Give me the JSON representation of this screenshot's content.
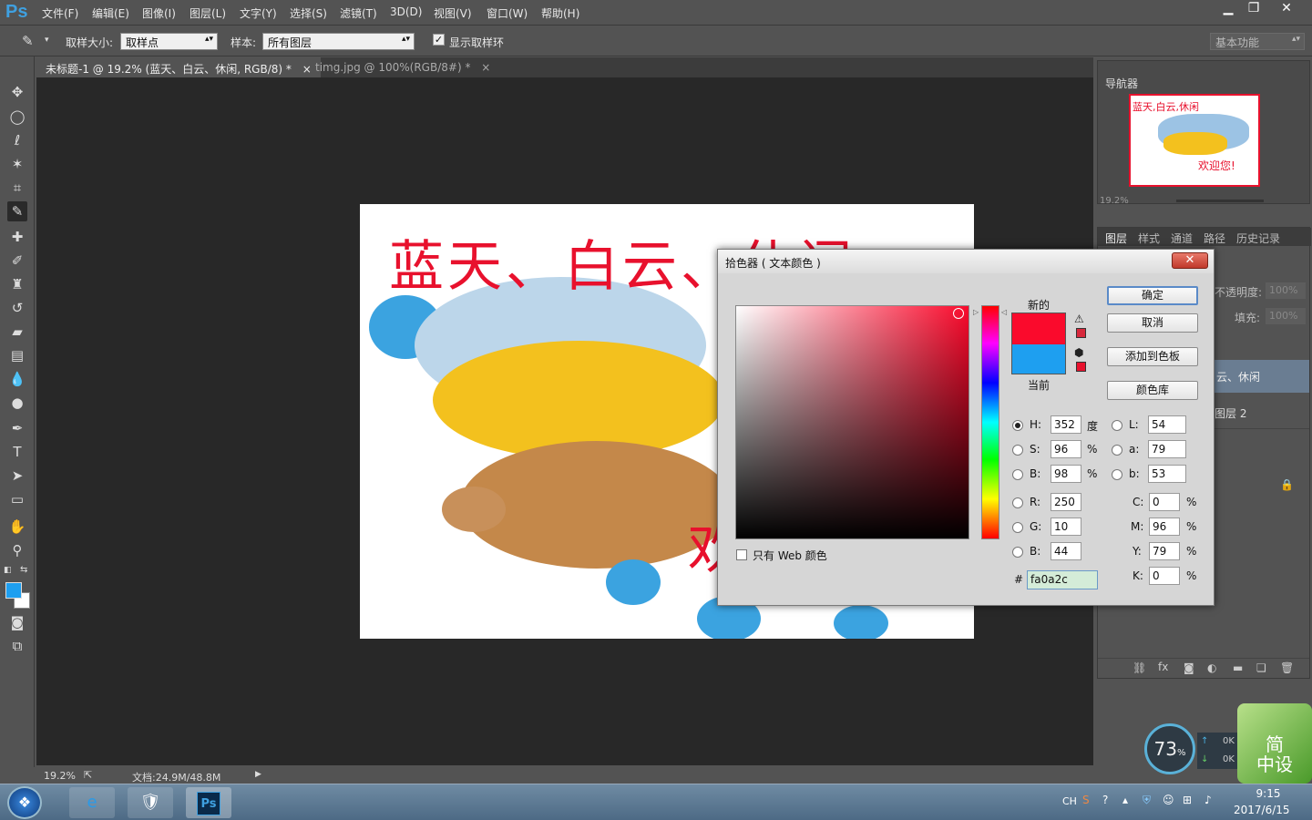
{
  "app": {
    "logo": "Ps"
  },
  "menu": [
    "文件(F)",
    "编辑(E)",
    "图像(I)",
    "图层(L)",
    "文字(Y)",
    "选择(S)",
    "滤镜(T)",
    "3D(D)",
    "视图(V)",
    "窗口(W)",
    "帮助(H)"
  ],
  "window_controls": [
    "minimize-icon",
    "restore-icon",
    "close-icon"
  ],
  "options": {
    "sample_size_label": "取样大小:",
    "sample_size_value": "取样点",
    "sample_label": "样本:",
    "sample_value": "所有图层",
    "show_ring_label": "显示取样环",
    "workspace": "基本功能"
  },
  "tabs": [
    {
      "label": "未标题-1 @ 19.2% (蓝天、白云、休闲, RGB/8) *",
      "close": "×"
    },
    {
      "label": "timg.jpg @ 100%(RGB/8#) *",
      "close": "×"
    }
  ],
  "canvas": {
    "headline": "蓝天、白云、休闲",
    "partial_text": "欢"
  },
  "status": {
    "zoom": "19.2%",
    "doc": "文档:24.9M/48.8M"
  },
  "navigator": {
    "title": "导航器",
    "zoom": "19.2%",
    "thumb_text_top": "蓝天,白云,休闲",
    "thumb_text_bottom": "欢迎您!"
  },
  "layers_panel": {
    "tabs": [
      "图层",
      "样式",
      "通道",
      "路径",
      "历史记录"
    ],
    "opacity_label": "不透明度:",
    "opacity_value": "100%",
    "fill_label": "填充:",
    "fill_value": "100%",
    "layers": [
      "云、休闲",
      "图层 2"
    ]
  },
  "dialog": {
    "title": "拾色器 ( 文本颜色 )",
    "close": "✕",
    "new_label": "新的",
    "current_label": "当前",
    "new_color": "#fa0a2c",
    "current_color": "#1e9ff0",
    "buttons": {
      "ok": "确定",
      "cancel": "取消",
      "add_swatch": "添加到色板",
      "libraries": "颜色库"
    },
    "web_only": "只有 Web 颜色",
    "hsb": {
      "h_label": "H:",
      "h": "352",
      "h_unit": "度",
      "s_label": "S:",
      "s": "96",
      "s_unit": "%",
      "b_label": "B:",
      "b": "98",
      "b_unit": "%"
    },
    "rgb": {
      "r_label": "R:",
      "r": "250",
      "g_label": "G:",
      "g": "10",
      "b_label": "B:",
      "b": "44"
    },
    "lab": {
      "l_label": "L:",
      "l": "54",
      "a_label": "a:",
      "a": "79",
      "b_label": "b:",
      "b": "53"
    },
    "cmyk": {
      "c_label": "C:",
      "c": "0",
      "m_label": "M:",
      "m": "96",
      "y_label": "Y:",
      "y": "79",
      "k_label": "K:",
      "k": "0",
      "unit": "%"
    },
    "hex_label": "#",
    "hex": "fa0a2c"
  },
  "widget": {
    "percent": "73",
    "unit": "%",
    "up": "0K",
    "down": "0K",
    "brand_top": "简",
    "brand_bottom": "中设"
  },
  "taskbar": {
    "lang": "CH",
    "time": "9:15",
    "date": "2017/6/15"
  }
}
